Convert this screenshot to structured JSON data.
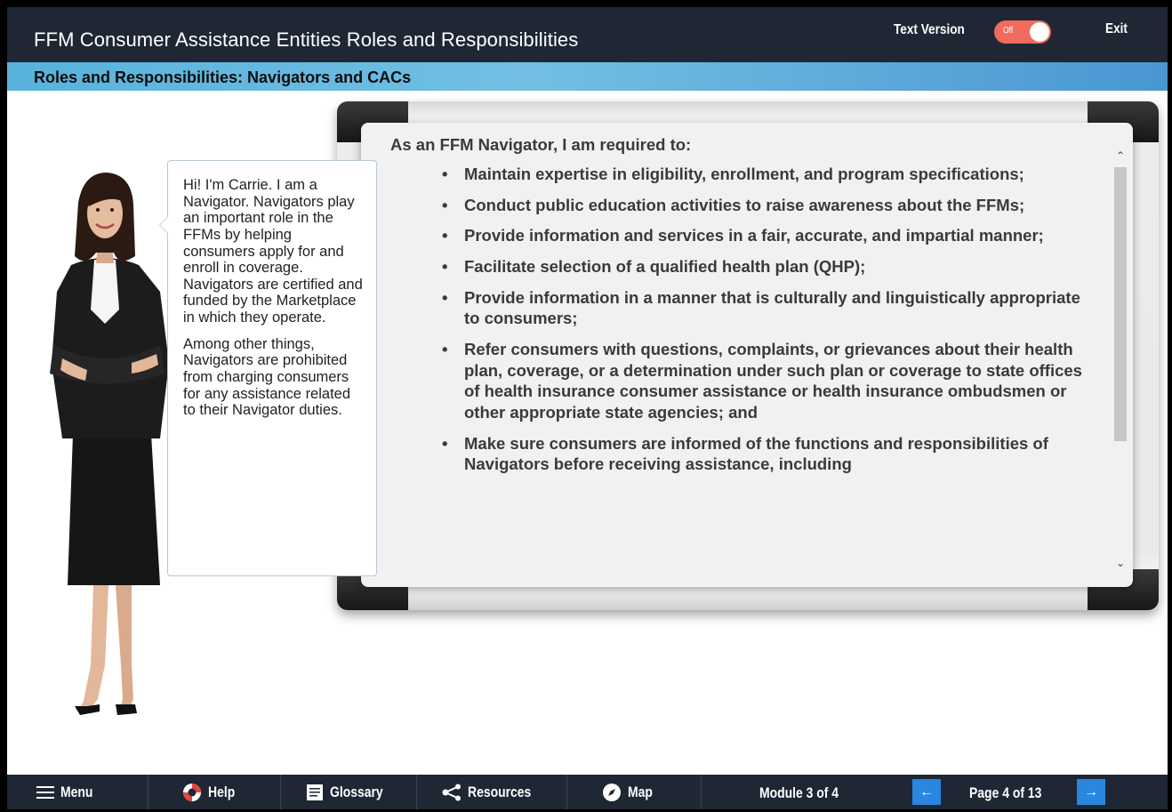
{
  "header": {
    "title": "FFM Consumer Assistance Entities Roles and Responsibilities",
    "text_version_label": "Text Version",
    "toggle_state": "Off",
    "exit_label": "Exit",
    "bar_color": "#1e2733",
    "toggle_color": "#f26b5e"
  },
  "subheader": {
    "title": "Roles and Responsibilities: Navigators and CACs"
  },
  "bubble": {
    "paragraphs": [
      "Hi! I'm Carrie. I am a Navigator. Navigators play an important role in the FFMs by helping consumers apply for and enroll in coverage. Navigators are certified and funded by the Marketplace in which they operate.",
      "Among other things, Navigators are prohibited from charging consumers for any assistance related to their Navigator duties."
    ]
  },
  "board": {
    "heading": "As an FFM Navigator, I am required to:",
    "items": [
      "Maintain expertise in eligibility, enrollment, and program specifications;",
      "Conduct public education activities to raise awareness about the FFMs;",
      "Provide information and services in a fair, accurate, and impartial manner;",
      "Facilitate selection of a qualified health plan (QHP);",
      "Provide information in a manner that is culturally and linguistically appropriate to consumers;",
      "Refer consumers with questions, complaints, or grievances about their health plan, coverage, or a determination under such plan or coverage to state offices of health insurance consumer assistance or health insurance ombudsmen or other appropriate state agencies; and",
      "Make sure consumers are informed of the functions and responsibilities of Navigators before receiving assistance, including"
    ]
  },
  "nav": {
    "menu_label": "Menu",
    "help_label": "Help",
    "glossary_label": "Glossary",
    "resources_label": "Resources",
    "map_label": "Map",
    "module_text": "Module 3 of 4",
    "page_text": "Page 4 of 13",
    "prev_icon": "arrow-left-icon",
    "next_icon": "arrow-right-icon",
    "accent_color": "#2a86de"
  }
}
